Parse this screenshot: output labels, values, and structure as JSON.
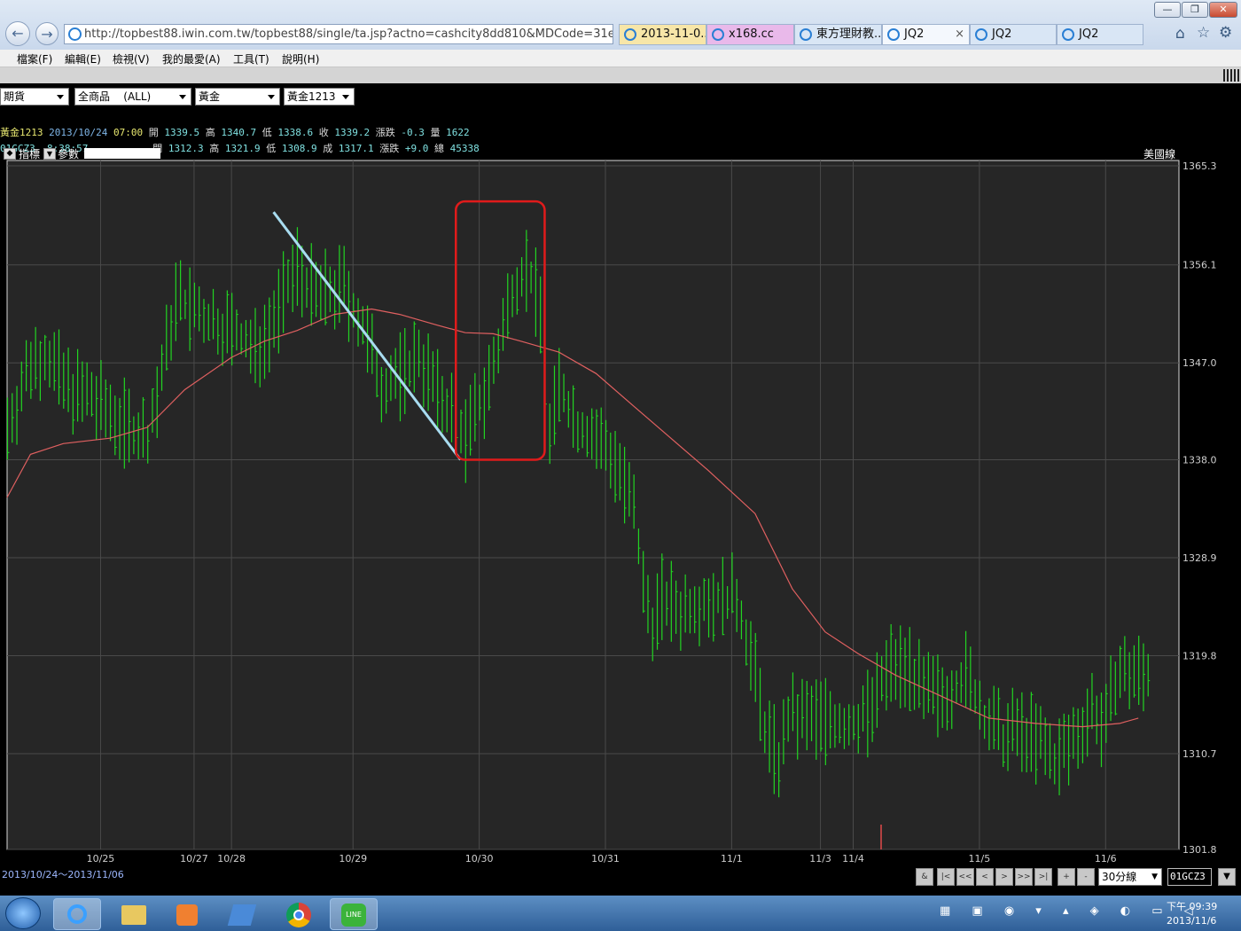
{
  "browser": {
    "url": "http://topbest88.iwin.com.tw/topbest88/single/ta.jsp?actno=cashcity8dd810&MDCode=31e",
    "tabs": [
      {
        "label": "2013-11-0...",
        "color": "#f7e6a8"
      },
      {
        "label": "x168.cc",
        "color": "#e9b9ea"
      },
      {
        "label": "東方理財教...",
        "color": "#d9e6f5"
      },
      {
        "label": "JQ2",
        "color": "#f4f8fd",
        "active": true
      },
      {
        "label": "JQ2",
        "color": "#d9e6f5"
      },
      {
        "label": "JQ2",
        "color": "#d9e6f5"
      }
    ],
    "tab_close": "×",
    "window_buttons": [
      "—",
      "❐",
      "✕"
    ]
  },
  "menu": [
    "檔案(F)",
    "編輯(E)",
    "檢視(V)",
    "我的最愛(A)",
    "工具(T)",
    "說明(H)"
  ],
  "selectors": {
    "market": "期貨",
    "product_group": "全商品    (ALL)",
    "commodity": "黃金",
    "contract": "黃金1213"
  },
  "quote1": {
    "name": "黃金1213",
    "date": "2013/10/24",
    "time": "07:00",
    "open_label": "開",
    "open": "1339.5",
    "high_label": "高",
    "high": "1340.7",
    "low_label": "低",
    "low": "1338.6",
    "close_label": "收",
    "close": "1339.2",
    "chg_label": "漲跌",
    "chg": "-0.3",
    "vol_label": "量",
    "vol": "1622"
  },
  "quote2": {
    "name": "01GCZ3",
    "time": "8:38:57",
    "open_label": "開",
    "open": "1312.3",
    "high_label": "高",
    "high": "1321.9",
    "low_label": "低",
    "low": "1308.9",
    "close_label": "成",
    "close": "1317.1",
    "chg_label": "漲跌",
    "chg": "+9.0",
    "vol_label": "總",
    "vol": "45338"
  },
  "indicator_bar": {
    "indicator": "指標",
    "params": "參數",
    "style": "美國線"
  },
  "chart_data": {
    "type": "ohlc",
    "bar_interval": "30分線",
    "date_range": "2013/10/24～2013/11/06",
    "y_ticks": [
      1365.3,
      1356.1,
      1347.0,
      1338.0,
      1328.9,
      1319.8,
      1310.7,
      1301.8
    ],
    "ylim": [
      1301.8,
      1365.3
    ],
    "x_ticks": [
      {
        "label": "10/25",
        "i": 20
      },
      {
        "label": "10/27",
        "i": 40
      },
      {
        "label": "10/28",
        "i": 48
      },
      {
        "label": "10/29",
        "i": 74
      },
      {
        "label": "10/30",
        "i": 101
      },
      {
        "label": "10/31",
        "i": 128
      },
      {
        "label": "11/1",
        "i": 155
      },
      {
        "label": "11/3",
        "i": 174
      },
      {
        "label": "11/4",
        "i": 181
      },
      {
        "label": "11/5",
        "i": 208
      },
      {
        "label": "11/6",
        "i": 235
      }
    ],
    "series_color": "#22d422",
    "ma_color": "#e06060",
    "price_path": [
      [
        0,
        1341
      ],
      [
        5,
        1347
      ],
      [
        8,
        1348
      ],
      [
        12,
        1345
      ],
      [
        20,
        1343
      ],
      [
        26,
        1341
      ],
      [
        30,
        1340
      ],
      [
        33,
        1346
      ],
      [
        36,
        1353
      ],
      [
        42,
        1351
      ],
      [
        48,
        1350
      ],
      [
        53,
        1348
      ],
      [
        58,
        1352
      ],
      [
        62,
        1356
      ],
      [
        66,
        1353
      ],
      [
        72,
        1354
      ],
      [
        76,
        1350
      ],
      [
        80,
        1345
      ],
      [
        85,
        1346
      ],
      [
        88,
        1348
      ],
      [
        92,
        1344
      ],
      [
        96,
        1342
      ],
      [
        98,
        1340
      ],
      [
        101,
        1343
      ],
      [
        105,
        1348
      ],
      [
        108,
        1354
      ],
      [
        111,
        1356
      ],
      [
        114,
        1352
      ],
      [
        116,
        1340
      ],
      [
        118,
        1345
      ],
      [
        122,
        1341
      ],
      [
        126,
        1340
      ],
      [
        130,
        1338
      ],
      [
        134,
        1333
      ],
      [
        136,
        1326
      ],
      [
        138,
        1323
      ],
      [
        140,
        1325
      ],
      [
        144,
        1324
      ],
      [
        148,
        1325
      ],
      [
        152,
        1325
      ],
      [
        156,
        1325
      ],
      [
        159,
        1320
      ],
      [
        162,
        1313
      ],
      [
        165,
        1310
      ],
      [
        167,
        1314
      ],
      [
        170,
        1314
      ],
      [
        175,
        1314
      ],
      [
        180,
        1313
      ],
      [
        185,
        1315
      ],
      [
        189,
        1319
      ],
      [
        193,
        1319
      ],
      [
        196,
        1316
      ],
      [
        200,
        1316
      ],
      [
        205,
        1318
      ],
      [
        209,
        1314
      ],
      [
        213,
        1312
      ],
      [
        216,
        1313
      ],
      [
        220,
        1312
      ],
      [
        224,
        1310
      ],
      [
        228,
        1312
      ],
      [
        232,
        1315
      ],
      [
        235,
        1313
      ],
      [
        237,
        1318
      ],
      [
        241,
        1318
      ]
    ],
    "ma": [
      [
        0,
        1334.5
      ],
      [
        5,
        1338.5
      ],
      [
        12,
        1339.5
      ],
      [
        22,
        1340
      ],
      [
        30,
        1341
      ],
      [
        38,
        1344.5
      ],
      [
        48,
        1347.5
      ],
      [
        55,
        1349
      ],
      [
        62,
        1350
      ],
      [
        70,
        1351.5
      ],
      [
        78,
        1352
      ],
      [
        84,
        1351.5
      ],
      [
        92,
        1350.5
      ],
      [
        98,
        1349.8
      ],
      [
        104,
        1349.7
      ],
      [
        110,
        1349
      ],
      [
        118,
        1348
      ],
      [
        126,
        1346
      ],
      [
        134,
        1343
      ],
      [
        142,
        1340
      ],
      [
        150,
        1337
      ],
      [
        160,
        1333
      ],
      [
        168,
        1326
      ],
      [
        175,
        1322
      ],
      [
        182,
        1320
      ],
      [
        190,
        1318
      ],
      [
        200,
        1316
      ],
      [
        210,
        1314
      ],
      [
        220,
        1313.5
      ],
      [
        230,
        1313.2
      ],
      [
        238,
        1313.5
      ],
      [
        242,
        1314
      ]
    ],
    "annotations": [
      {
        "type": "trendline",
        "color": "#a8dcf0",
        "from": [
          57,
          1361
        ],
        "to": [
          97,
          1338
        ]
      },
      {
        "type": "rectangle",
        "color": "#e01b1b",
        "from": [
          96,
          1362
        ],
        "to": [
          115,
          1338
        ]
      }
    ]
  },
  "bottom_controls": {
    "buttons": [
      "&",
      "|<",
      "<<",
      "<",
      ">",
      ">>",
      ">|",
      "+",
      "-"
    ],
    "interval": "30分線",
    "symbol": "01GCZ3"
  },
  "taskbar": {
    "time": "下午 09:39",
    "date": "2013/11/6"
  }
}
